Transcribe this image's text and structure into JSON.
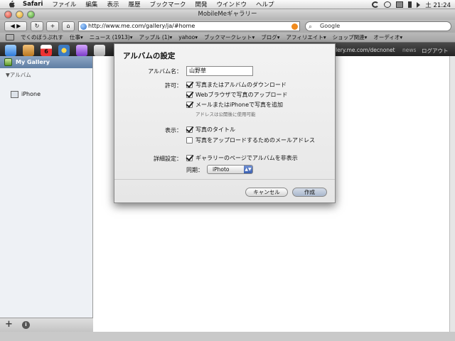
{
  "menubar": {
    "app": "Safari",
    "items": [
      "ファイル",
      "編集",
      "表示",
      "履歴",
      "ブックマーク",
      "開発",
      "ウインドウ",
      "ヘルプ"
    ],
    "clock": "土 21:24"
  },
  "window": {
    "title": "MobileMeギャラリー"
  },
  "toolbar": {
    "add_label": "+",
    "url": "http://www.me.com/gallery/ja/#home",
    "search_placeholder": "Google"
  },
  "bookmarks": [
    "でくのぼうぷれす",
    "仕事▾",
    "ニュース (1913)▾",
    "アップル (1)▾",
    "yahoo▾",
    "ブックマークレット▾",
    "ブログ▾",
    "アフィリエイト▾",
    "ショップ関連▾",
    "オーディオ▾"
  ],
  "appbar": {
    "calendar_day": "6",
    "url_text": "llery.me.com/decnonet",
    "news": "news",
    "logout": "ログアウト"
  },
  "sidebar": {
    "gallery": "My Gallery",
    "albums_heading": "▼アルバム",
    "album_item": "iPhone",
    "add": "+",
    "info": "i"
  },
  "dialog": {
    "title": "アルバムの設定",
    "name_label": "アルバム名：",
    "name_value": "山野草",
    "permit_label": "許可：",
    "permit_download": "写真またはアルバムのダウンロード",
    "permit_upload_web": "Webブラウザで写真のアップロード",
    "permit_upload_mail": "メールまたはiPhoneで写真を追加",
    "permit_note": "アドレスは公開後に使用可能",
    "display_label": "表示：",
    "display_titles": "写真のタイトル",
    "display_email": "写真をアップロードするためのメールアドレス",
    "advanced_label": "詳細設定：",
    "advanced_hide": "ギャラリーのページでアルバムを非表示",
    "sync_label": "同期：",
    "sync_value": "iPhoto",
    "cancel": "キャンセル",
    "create": "作成"
  }
}
